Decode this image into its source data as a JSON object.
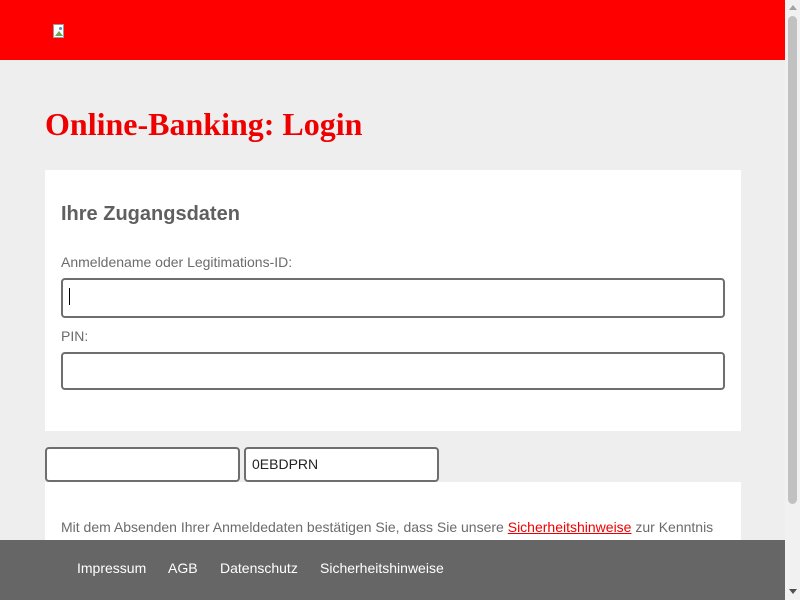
{
  "header": {
    "brand_color": "#ff0000",
    "logo_icon": "broken-image-icon"
  },
  "page": {
    "title": "Online-Banking: Login"
  },
  "login": {
    "section_title": "Ihre Zugangsdaten",
    "username_label": "Anmeldename oder Legitimations-ID:",
    "username_value": "",
    "pin_label": "PIN:",
    "pin_value": ""
  },
  "captcha": {
    "input_value": "",
    "code_value": "0EBDPRN"
  },
  "notice": {
    "text_before": "Mit dem Absenden Ihrer Anmeldedaten bestätigen Sie, dass Sie unsere ",
    "link_label": "Sicherheitshinweise",
    "text_after": " zur Kenntnis"
  },
  "footer": {
    "background": "#666666",
    "links": [
      "Impressum",
      "AGB",
      "Datenschutz",
      "Sicherheitshinweise"
    ]
  }
}
